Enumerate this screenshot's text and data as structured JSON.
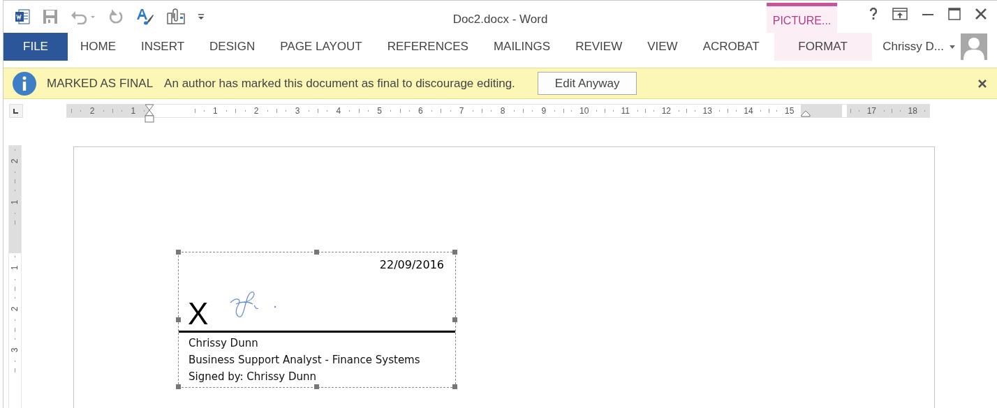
{
  "window": {
    "title": "Doc2.docx - Word",
    "contextual_group": "PICTURE..."
  },
  "ribbon_tabs": [
    {
      "label": "FILE",
      "kind": "file",
      "selected": true
    },
    {
      "label": "HOME",
      "kind": "tab",
      "selected": false
    },
    {
      "label": "INSERT",
      "kind": "tab",
      "selected": false
    },
    {
      "label": "DESIGN",
      "kind": "tab",
      "selected": false
    },
    {
      "label": "PAGE LAYOUT",
      "kind": "tab",
      "selected": false
    },
    {
      "label": "REFERENCES",
      "kind": "tab",
      "selected": false
    },
    {
      "label": "MAILINGS",
      "kind": "tab",
      "selected": false
    },
    {
      "label": "REVIEW",
      "kind": "tab",
      "selected": false
    },
    {
      "label": "VIEW",
      "kind": "tab",
      "selected": false
    },
    {
      "label": "ACROBAT",
      "kind": "tab",
      "selected": false
    },
    {
      "label": "FORMAT",
      "kind": "contextual",
      "selected": false
    }
  ],
  "account": {
    "name": "Chrissy D..."
  },
  "info_bar": {
    "title": "MARKED AS FINAL",
    "message": "An author has marked this document as final to discourage editing.",
    "button": "Edit Anyway"
  },
  "ruler": {
    "left_labels": [
      "2",
      "1"
    ],
    "labels": [
      "1",
      "2",
      "3",
      "4",
      "5",
      "6",
      "7",
      "8",
      "9",
      "10",
      "11",
      "12",
      "13",
      "14",
      "15"
    ],
    "right_labels": [
      "17",
      "18"
    ]
  },
  "vertical_ruler": {
    "top_labels": [
      "2",
      "1"
    ],
    "labels": [
      "1",
      "2",
      "3"
    ]
  },
  "signature": {
    "date": "22/09/2016",
    "mark": "X",
    "lines": [
      "Chrissy Dunn",
      "Business Support Analyst - Finance Systems",
      "Signed by: Chrissy Dunn"
    ]
  }
}
